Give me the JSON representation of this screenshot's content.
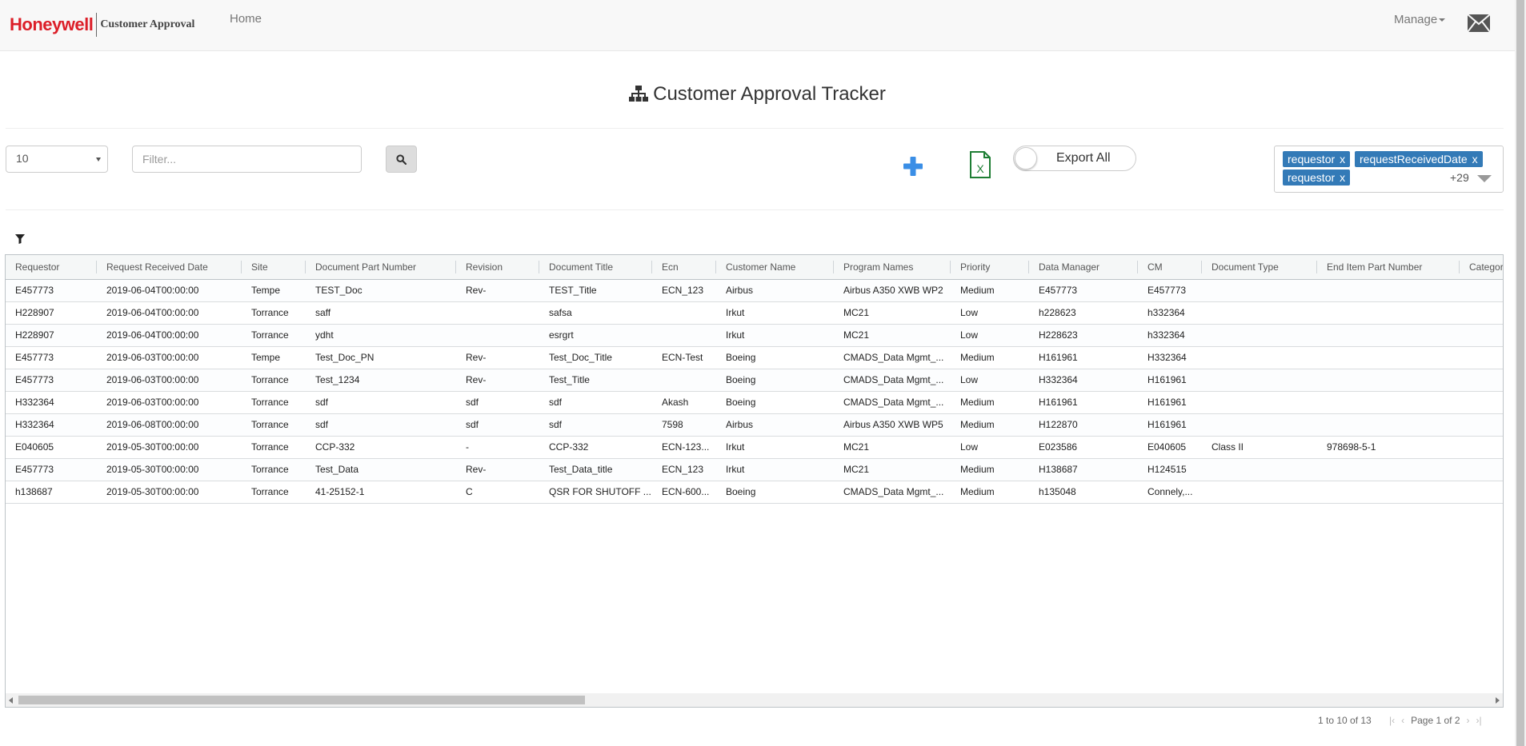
{
  "nav": {
    "brand": "Honeywell",
    "brand_sub": "Customer Approval",
    "home": "Home",
    "manage": "Manage"
  },
  "page": {
    "title": "Customer Approval Tracker"
  },
  "controls": {
    "page_size": "10",
    "filter_placeholder": "Filter...",
    "export_all": "Export All"
  },
  "columns_selector": {
    "chips": [
      "requestor",
      "requestReceivedDate",
      "requestor"
    ],
    "remove": "x",
    "more": "+29"
  },
  "grid": {
    "headers": [
      "Requestor",
      "Request Received Date",
      "Site",
      "Document Part Number",
      "Revision",
      "Document Title",
      "Ecn",
      "Customer Name",
      "Program Names",
      "Priority",
      "Data Manager",
      "CM",
      "Document Type",
      "End Item Part Number",
      "Category"
    ],
    "rows": [
      [
        "E457773",
        "2019-06-04T00:00:00",
        "Tempe",
        "TEST_Doc",
        "Rev-",
        "TEST_Title",
        "ECN_123",
        "Airbus",
        "Airbus A350 XWB WP2",
        "Medium",
        "E457773",
        "E457773",
        "",
        "",
        ""
      ],
      [
        "H228907",
        "2019-06-04T00:00:00",
        "Torrance",
        "saff",
        "",
        "safsa",
        "",
        "Irkut",
        "MC21",
        "Low",
        "h228623",
        "h332364",
        "",
        "",
        ""
      ],
      [
        "H228907",
        "2019-06-04T00:00:00",
        "Torrance",
        "ydht",
        "",
        "esrgrt",
        "",
        "Irkut",
        "MC21",
        "Low",
        "H228623",
        "h332364",
        "",
        "",
        ""
      ],
      [
        "E457773",
        "2019-06-03T00:00:00",
        "Tempe",
        "Test_Doc_PN",
        "Rev-",
        "Test_Doc_Title",
        "ECN-Test",
        "Boeing",
        "CMADS_Data Mgmt_...",
        "Medium",
        "H161961",
        "H332364",
        "",
        "",
        ""
      ],
      [
        "E457773",
        "2019-06-03T00:00:00",
        "Torrance",
        "Test_1234",
        "Rev-",
        "Test_Title",
        "",
        "Boeing",
        "CMADS_Data Mgmt_...",
        "Low",
        "H332364",
        "H161961",
        "",
        "",
        ""
      ],
      [
        "H332364",
        "2019-06-03T00:00:00",
        "Torrance",
        "sdf",
        "sdf",
        "sdf",
        "Akash",
        "Boeing",
        "CMADS_Data Mgmt_...",
        "Medium",
        "H161961",
        "H161961",
        "",
        "",
        ""
      ],
      [
        "H332364",
        "2019-06-08T00:00:00",
        "Torrance",
        "sdf",
        "sdf",
        "sdf",
        "7598",
        "Airbus",
        "Airbus A350 XWB WP5",
        "Medium",
        "H122870",
        "H161961",
        "",
        "",
        ""
      ],
      [
        "E040605",
        "2019-05-30T00:00:00",
        "Torrance",
        "CCP-332",
        "-",
        "CCP-332",
        "ECN-123...",
        "Irkut",
        "MC21",
        "Low",
        "E023586",
        "E040605",
        "Class II",
        "978698-5-1",
        ""
      ],
      [
        "E457773",
        "2019-05-30T00:00:00",
        "Torrance",
        "Test_Data",
        "Rev-",
        "Test_Data_title",
        "ECN_123",
        "Irkut",
        "MC21",
        "Medium",
        "H138687",
        "H124515",
        "",
        "",
        ""
      ],
      [
        "h138687",
        "2019-05-30T00:00:00",
        "Torrance",
        "41-25152-1",
        "C",
        "QSR FOR SHUTOFF ...",
        "ECN-600...",
        "Boeing",
        "CMADS_Data Mgmt_...",
        "Medium",
        "h135048",
        "Connely,...",
        "",
        "",
        ""
      ]
    ]
  },
  "pager": {
    "summary": "1 to 10 of 13",
    "page_label": "Page 1 of 2"
  },
  "colors": {
    "brand_red": "#dc1e28",
    "chip_blue": "#337ab7",
    "add_blue": "#3a8ee6",
    "excel_green": "#1e7e34"
  },
  "icons": [
    "sitemap-icon",
    "search-icon",
    "plus-icon",
    "excel-icon",
    "mail-icon",
    "filter-icon",
    "chevron-down-icon"
  ]
}
